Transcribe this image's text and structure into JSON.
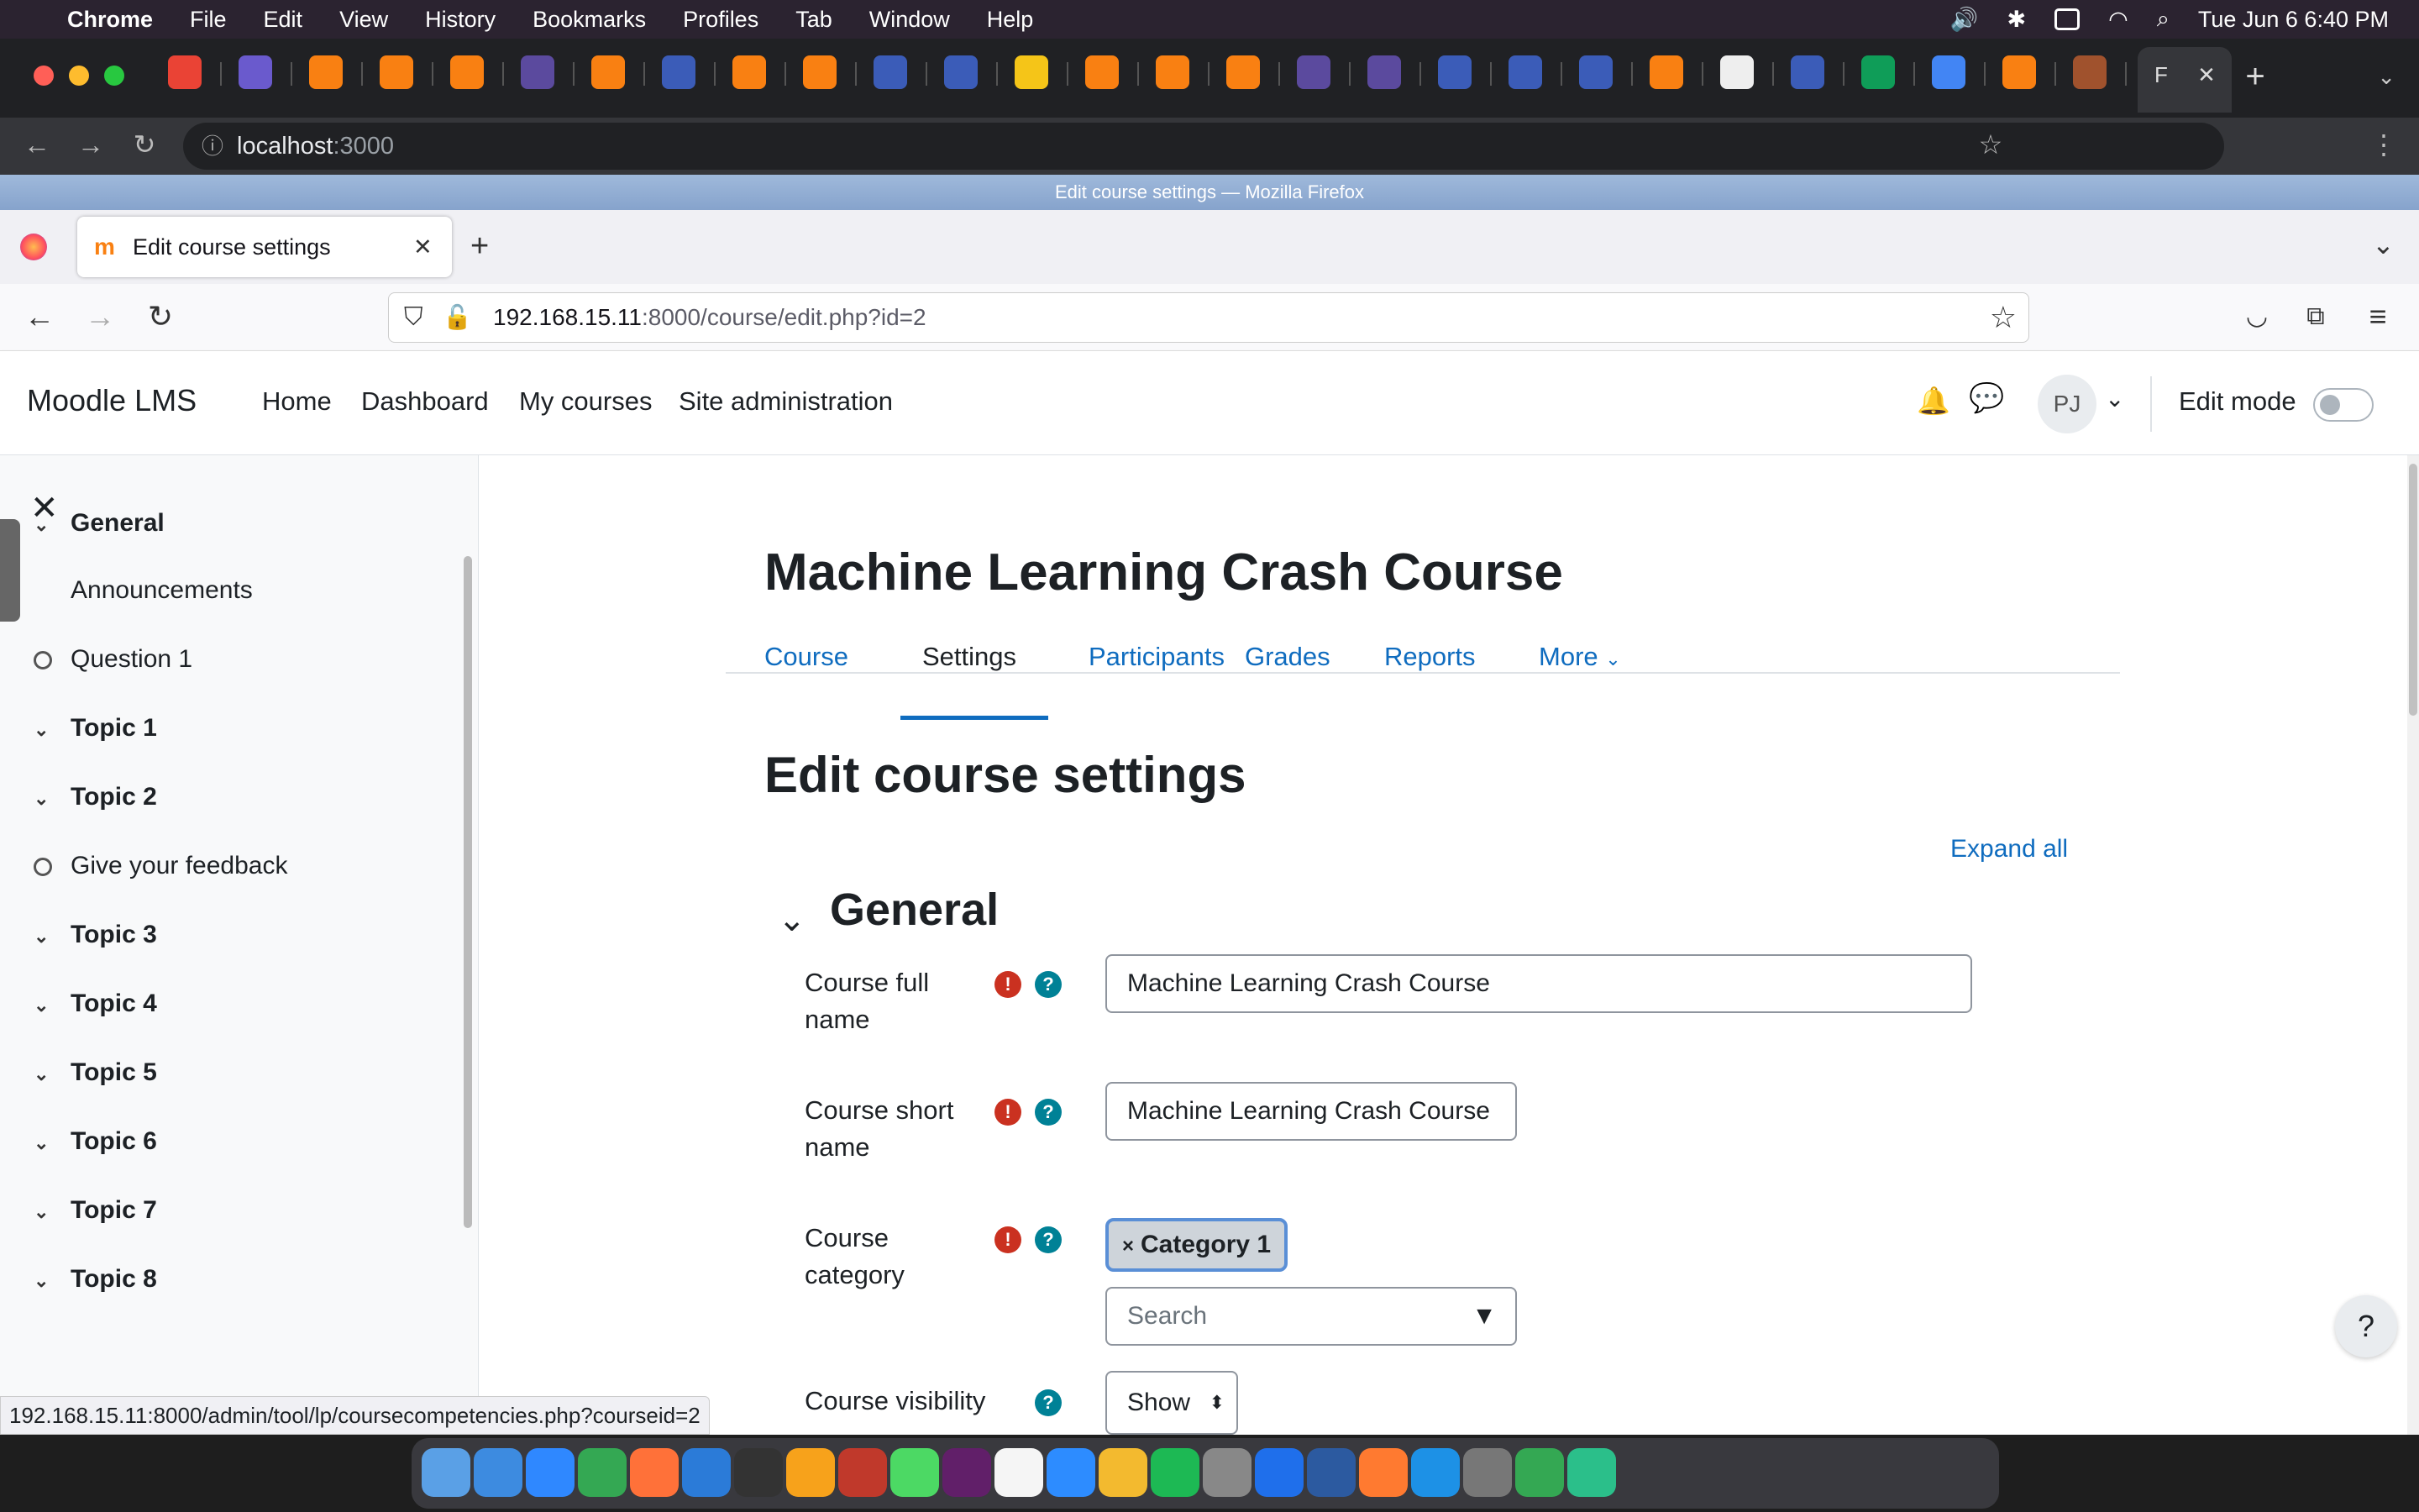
{
  "menubar": {
    "app_name": "Chrome",
    "items": [
      "File",
      "Edit",
      "View",
      "History",
      "Bookmarks",
      "Profiles",
      "Tab",
      "Window",
      "Help"
    ],
    "datetime": "Tue Jun 6  6:40 PM"
  },
  "chrome": {
    "active_tab_label": "F",
    "url_host": "localhost",
    "url_port": ":3000"
  },
  "firefox": {
    "window_title": "Edit course settings — Mozilla Firefox",
    "tab_title": "Edit course settings",
    "url_host": "192.168.15.11",
    "url_rest": ":8000/course/edit.php?id=2",
    "status_url": "192.168.15.11:8000/admin/tool/lp/coursecompetencies.php?courseid=2"
  },
  "moodle": {
    "brand": "Moodle LMS",
    "nav": [
      "Home",
      "Dashboard",
      "My courses",
      "Site administration"
    ],
    "avatar_initials": "PJ",
    "edit_mode_label": "Edit mode",
    "course_index": [
      {
        "label": "General",
        "type": "section"
      },
      {
        "label": "Announcements",
        "type": "activity-plain"
      },
      {
        "label": "Question 1",
        "type": "activity"
      },
      {
        "label": "Topic 1",
        "type": "section"
      },
      {
        "label": "Topic 2",
        "type": "section"
      },
      {
        "label": "Give your feedback",
        "type": "activity"
      },
      {
        "label": "Topic 3",
        "type": "section"
      },
      {
        "label": "Topic 4",
        "type": "section"
      },
      {
        "label": "Topic 5",
        "type": "section"
      },
      {
        "label": "Topic 6",
        "type": "section"
      },
      {
        "label": "Topic 7",
        "type": "section"
      },
      {
        "label": "Topic 8",
        "type": "section"
      }
    ],
    "course_title": "Machine Learning Crash Course",
    "secondary_nav": [
      "Course",
      "Settings",
      "Participants",
      "Grades",
      "Reports",
      "More"
    ],
    "secondary_nav_active": "Settings",
    "page_heading": "Edit course settings",
    "expand_all": "Expand all",
    "section_heading": "General",
    "form": {
      "fullname_label": "Course full name",
      "fullname_value": "Machine Learning Crash Course",
      "shortname_label": "Course short name",
      "shortname_value": "Machine Learning Crash Course",
      "category_label": "Course category",
      "category_selected": "Category 1",
      "category_search_placeholder": "Search",
      "visibility_label": "Course visibility",
      "visibility_value": "Show"
    },
    "help_button": "?"
  }
}
